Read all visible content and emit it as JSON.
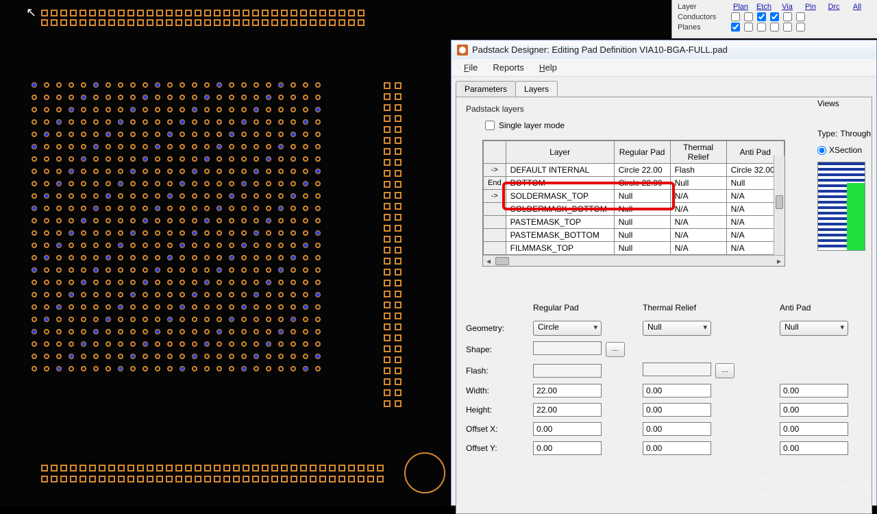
{
  "bg_panel": {
    "headers": [
      "Layer",
      "Plan",
      "Etch",
      "Via",
      "Pin",
      "Drc",
      "All"
    ],
    "rows": [
      {
        "label": "Conductors",
        "checks": [
          false,
          false,
          true,
          true,
          false,
          false
        ]
      },
      {
        "label": "Planes",
        "checks": [
          true,
          false,
          false,
          false,
          false,
          false
        ]
      }
    ]
  },
  "dialog": {
    "title": "Padstack Designer: Editing Pad Definition VIA10-BGA-FULL.pad",
    "menu": {
      "file": "File",
      "reports": "Reports",
      "help": "Help"
    },
    "tabs": {
      "parameters": "Parameters",
      "layers": "Layers"
    },
    "section": "Padstack layers",
    "single_layer": "Single layer mode",
    "columns": [
      "",
      "Layer",
      "Regular Pad",
      "Thermal Relief",
      "Anti Pad"
    ],
    "rows": [
      {
        "hdr": "->",
        "layer": "DEFAULT INTERNAL",
        "reg": "Circle 22.00",
        "thm": "Flash",
        "anti": "Circle 32.00"
      },
      {
        "hdr": "End",
        "layer": "BOTTOM",
        "reg": "Circle 22.00",
        "thm": "Null",
        "anti": "Null"
      },
      {
        "hdr": "->",
        "layer": "SOLDERMASK_TOP",
        "reg": "Null",
        "thm": "N/A",
        "anti": "N/A"
      },
      {
        "hdr": "",
        "layer": "SOLDERMASK_BOTTOM",
        "reg": "Null",
        "thm": "N/A",
        "anti": "N/A"
      },
      {
        "hdr": "",
        "layer": "PASTEMASK_TOP",
        "reg": "Null",
        "thm": "N/A",
        "anti": "N/A"
      },
      {
        "hdr": "",
        "layer": "PASTEMASK_BOTTOM",
        "reg": "Null",
        "thm": "N/A",
        "anti": "N/A"
      },
      {
        "hdr": "",
        "layer": "FILMMASK_TOP",
        "reg": "Null",
        "thm": "N/A",
        "anti": "N/A"
      }
    ],
    "views": {
      "title": "Views",
      "type_lbl": "Type:",
      "type_val": "Through",
      "xsection": "XSection"
    },
    "form": {
      "col_headers": {
        "reg": "Regular Pad",
        "thm": "Thermal Relief",
        "anti": "Anti Pad"
      },
      "labels": {
        "geometry": "Geometry:",
        "shape": "Shape:",
        "flash": "Flash:",
        "width": "Width:",
        "height": "Height:",
        "ox": "Offset X:",
        "oy": "Offset Y:"
      },
      "reg": {
        "geom": "Circle",
        "shape": "",
        "flash": "",
        "w": "22.00",
        "h": "22.00",
        "ox": "0.00",
        "oy": "0.00"
      },
      "thm": {
        "geom": "Null",
        "flash": "",
        "w": "0.00",
        "h": "0.00",
        "ox": "0.00",
        "oy": "0.00"
      },
      "anti": {
        "geom": "Null",
        "w": "0.00",
        "h": "0.00",
        "ox": "0.00",
        "oy": "0.00"
      },
      "dots": "..."
    }
  },
  "watermark": "@EDADOC一博科技"
}
